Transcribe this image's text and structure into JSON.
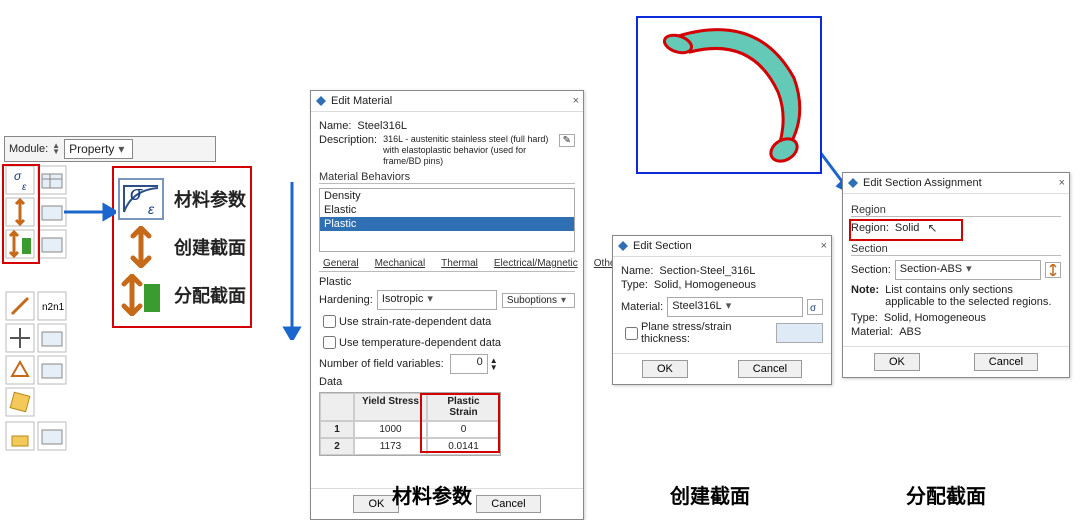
{
  "colors": {
    "accent": "#2f6fb3",
    "red": "#d40000",
    "blue": "#0b2bd8",
    "teal": "#65c9b8",
    "highlight": "#2f6fb3"
  },
  "module": {
    "label": "Module:",
    "value": "Property"
  },
  "toolbar_legend": [
    {
      "icon": "sigma-epsilon-icon",
      "label": "材料参数"
    },
    {
      "icon": "create-section-icon",
      "label": "创建截面"
    },
    {
      "icon": "assign-section-icon",
      "label": "分配截面"
    }
  ],
  "edit_material": {
    "title": "Edit Material",
    "name_label": "Name:",
    "name": "Steel316L",
    "desc_label": "Description:",
    "desc": "316L - austenitic stainless steel (full hard) with elastoplastic behavior (used for frame/BD pins)",
    "behaviors_head": "Material Behaviors",
    "behaviors": [
      "Density",
      "Elastic",
      "Plastic"
    ],
    "tabs": [
      "General",
      "Mechanical",
      "Thermal",
      "Electrical/Magnetic",
      "Other"
    ],
    "plastic_head": "Plastic",
    "hardening_label": "Hardening:",
    "hardening": "Isotropic",
    "suboptions": "Suboptions",
    "chk_rate": "Use strain-rate-dependent data",
    "chk_temp": "Use temperature-dependent data",
    "fieldvars_label": "Number of field variables:",
    "fieldvars": "0",
    "data_head": "Data",
    "table": {
      "headers": [
        "",
        "Yield Stress",
        "Plastic Strain"
      ],
      "rows": [
        [
          "1",
          "1000",
          "0"
        ],
        [
          "2",
          "1173",
          "0.0141"
        ]
      ]
    },
    "ok": "OK",
    "cancel": "Cancel"
  },
  "edit_section": {
    "title": "Edit Section",
    "name_label": "Name:",
    "name": "Section-Steel_316L",
    "type_label": "Type:",
    "type": "Solid, Homogeneous",
    "material_label": "Material:",
    "material": "Steel316L",
    "chk_plane": "Plane stress/strain thickness:",
    "ok": "OK",
    "cancel": "Cancel"
  },
  "edit_assign": {
    "title": "Edit Section Assignment",
    "region_head": "Region",
    "region_label": "Region:",
    "region": "Solid",
    "section_head": "Section",
    "section_label": "Section:",
    "section": "Section-ABS",
    "note_label": "Note:",
    "note": "List contains only sections applicable to the selected regions.",
    "type_label": "Type:",
    "type": "Solid, Homogeneous",
    "material_label": "Material:",
    "material": "ABS",
    "ok": "OK",
    "cancel": "Cancel"
  },
  "captions": {
    "c1": "材料参数",
    "c2": "创建截面",
    "c3": "分配截面"
  }
}
